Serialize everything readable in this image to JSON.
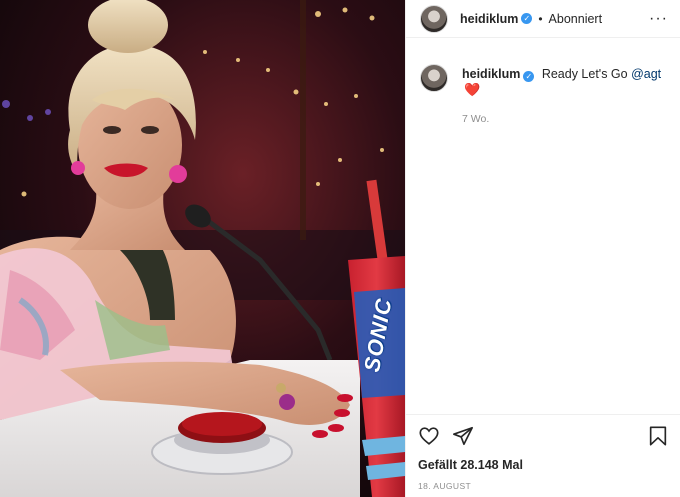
{
  "post": {
    "username": "heidiklum",
    "verified_mark": "✓",
    "separator": "•",
    "follow_status": "Abonniert",
    "more_label": "···",
    "caption_text": "Ready Let's Go",
    "mention": "@agt",
    "caption_emoji": "❤️",
    "time_ago": "7 Wo.",
    "likes_text": "Gefällt 28.148 Mal",
    "date": "18. AUGUST"
  },
  "photo": {
    "cup_brand": "SONIC"
  },
  "icons": {
    "more": "more-options-icon",
    "like": "heart-icon",
    "share": "share-icon",
    "save": "bookmark-icon",
    "verified": "verified-badge-icon"
  },
  "colors": {
    "verified_blue": "#3897f0",
    "mention_blue": "#00376b",
    "heart_red": "#e0245e",
    "muted_gray": "#8e8e8e"
  }
}
